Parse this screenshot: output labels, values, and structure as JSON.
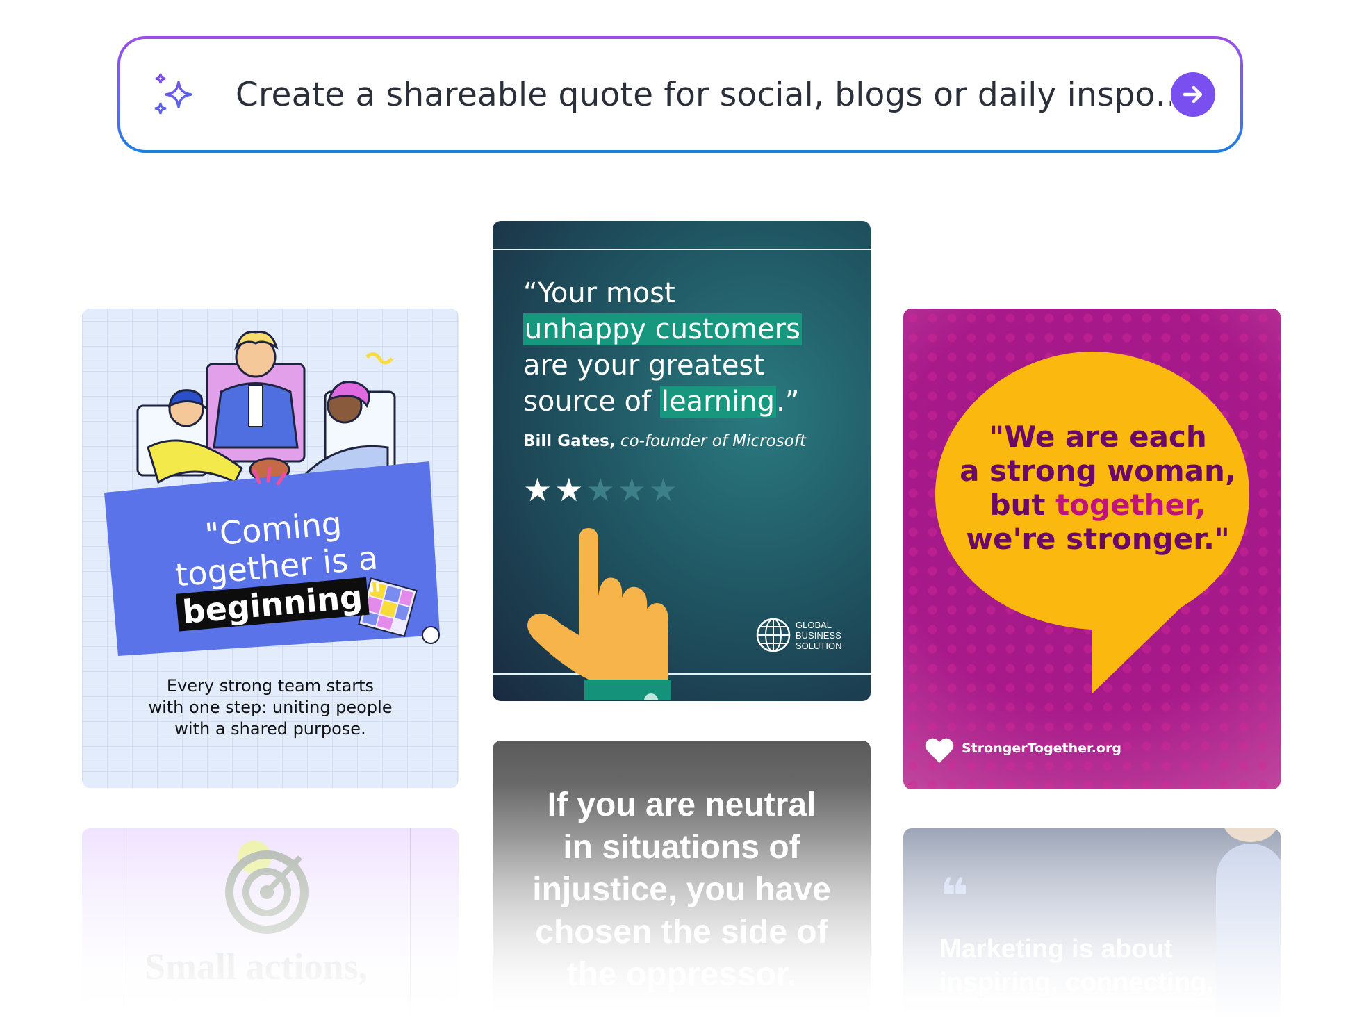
{
  "prompt": {
    "text": "Create a shareable quote for social, blogs or daily inspo…",
    "sparkle_icon": "sparkle-icon",
    "send_icon": "arrow-right-icon",
    "accent": "#7a4ff0"
  },
  "cards": {
    "team": {
      "quote_line1": "\"Coming",
      "quote_line2": "together is a",
      "quote_highlight": "beginning",
      "quote_close": "\"",
      "caption_line1": "Every strong team starts",
      "caption_line2": "with one step: uniting people",
      "caption_line3": "with a shared purpose."
    },
    "customers": {
      "line1": "“Your most",
      "line2_hl": "unhappy customers",
      "line3": "are your greatest",
      "line4_pre": "source of ",
      "line4_hl": "learning",
      "line4_post": ".”",
      "author_name": "Bill Gates,",
      "author_role": "co-founder of Microsoft",
      "rating": 2,
      "rating_max": 5,
      "logo_line1": "GLOBAL",
      "logo_line2": "BUSINESS",
      "logo_line3": "SOLUTION"
    },
    "women": {
      "line1": "\"We are each",
      "line2": "a strong woman,",
      "line3_pre": "but ",
      "line3_hl": "together,",
      "line4": "we're stronger.\"",
      "site": "StrongerTogether.org"
    },
    "small_actions": {
      "text": "Small actions,"
    },
    "neutral": {
      "line1": "If you are neutral",
      "line2": "in situations of",
      "line3": "injustice, you have",
      "line4": "chosen the side of",
      "line5": "the oppressor."
    },
    "marketing": {
      "quote_mark": "❝",
      "line1": "Marketing is about",
      "line2": "inspiring, connecting,"
    }
  }
}
